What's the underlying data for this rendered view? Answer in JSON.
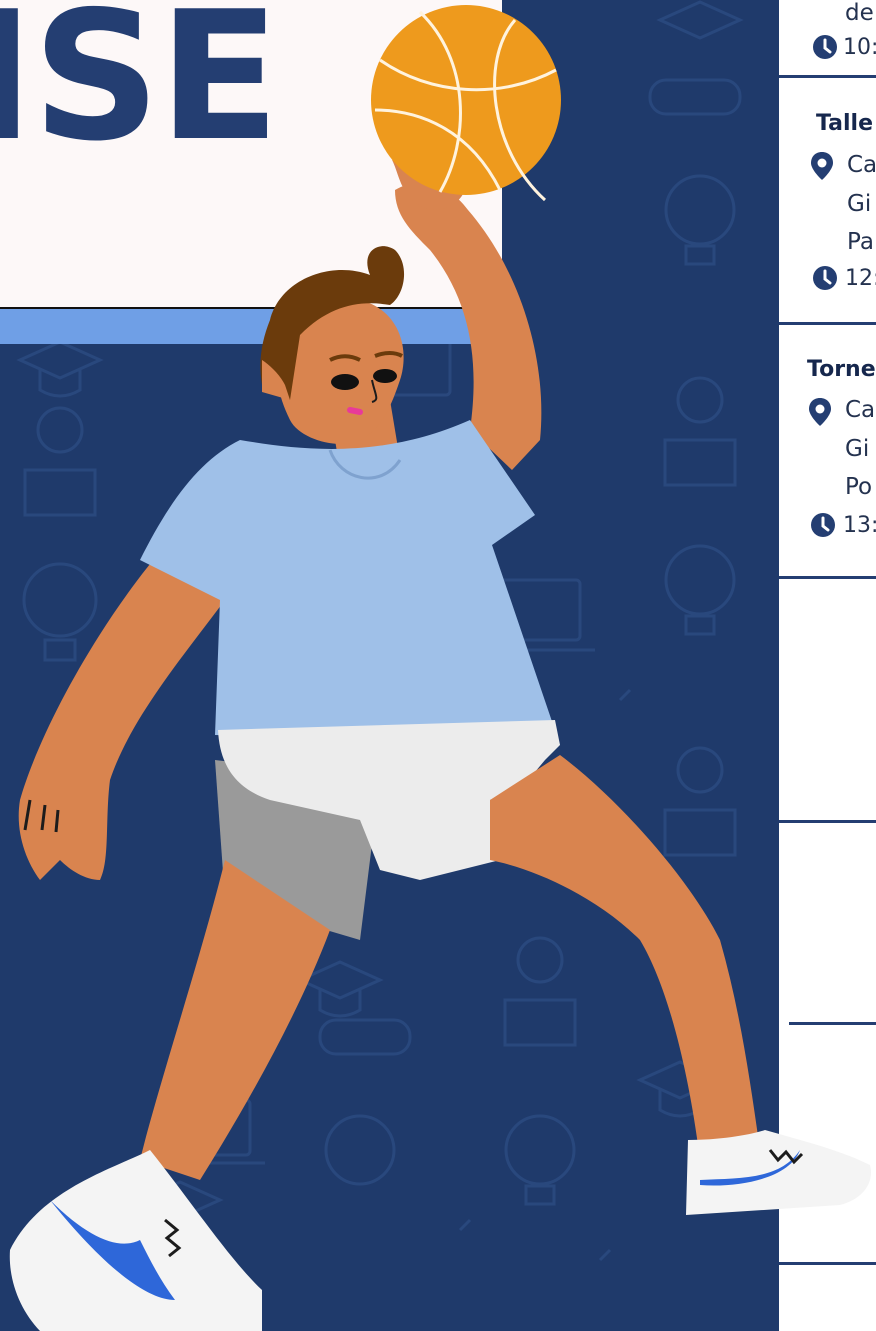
{
  "poster": {
    "title_fragment": "ISE"
  },
  "events": [
    {
      "title_fragment": "",
      "location_lines": [
        "de"
      ],
      "time_fragment": "10:"
    },
    {
      "title_fragment": "Talle",
      "location_lines": [
        "Ca",
        "Gi",
        "Pa"
      ],
      "time_fragment": "12:"
    },
    {
      "title_fragment": "Torne",
      "location_lines": [
        "Ca",
        "Gi",
        "Po"
      ],
      "time_fragment": "13:"
    }
  ],
  "icons": {
    "location": "map-pin-icon",
    "time": "clock-icon"
  },
  "colors": {
    "navy_background": "#1f3a6b",
    "title_navy": "#243e72",
    "accent_blue": "#6f9fe6",
    "ball_orange": "#ee9a1d",
    "skin": "#d9844f",
    "shirt": "#9fc0e8",
    "sneaker_swoosh": "#2e67d9"
  }
}
